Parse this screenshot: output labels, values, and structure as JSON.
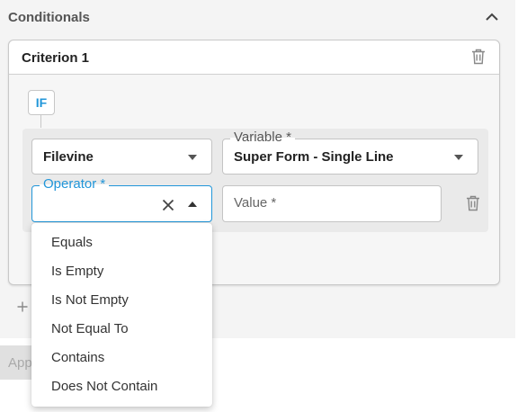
{
  "conditionals": {
    "title": "Conditionals",
    "collapse_icon": "chevron-up-icon"
  },
  "criterion": {
    "title": "Criterion 1",
    "delete_icon": "trash-icon",
    "if_label": "IF"
  },
  "source_field": {
    "value": "Filevine",
    "icon": "caret-down-icon"
  },
  "variable_field": {
    "label": "Variable *",
    "value": "Super Form - Single Line",
    "icon": "caret-down-icon"
  },
  "operator_field": {
    "label": "Operator *",
    "value": "",
    "clear_icon": "close-icon",
    "toggle_icon": "caret-up-icon",
    "options": [
      "Equals",
      "Is Empty",
      "Is Not Empty",
      "Not Equal To",
      "Contains",
      "Does Not Contain"
    ]
  },
  "value_field": {
    "placeholder": "Value *"
  },
  "row_delete_icon": "trash-icon",
  "add_icon": "plus-icon",
  "apply_button": {
    "label": "App"
  },
  "colors": {
    "accent": "#2196d9",
    "panel_bg": "#f4f4f4"
  }
}
